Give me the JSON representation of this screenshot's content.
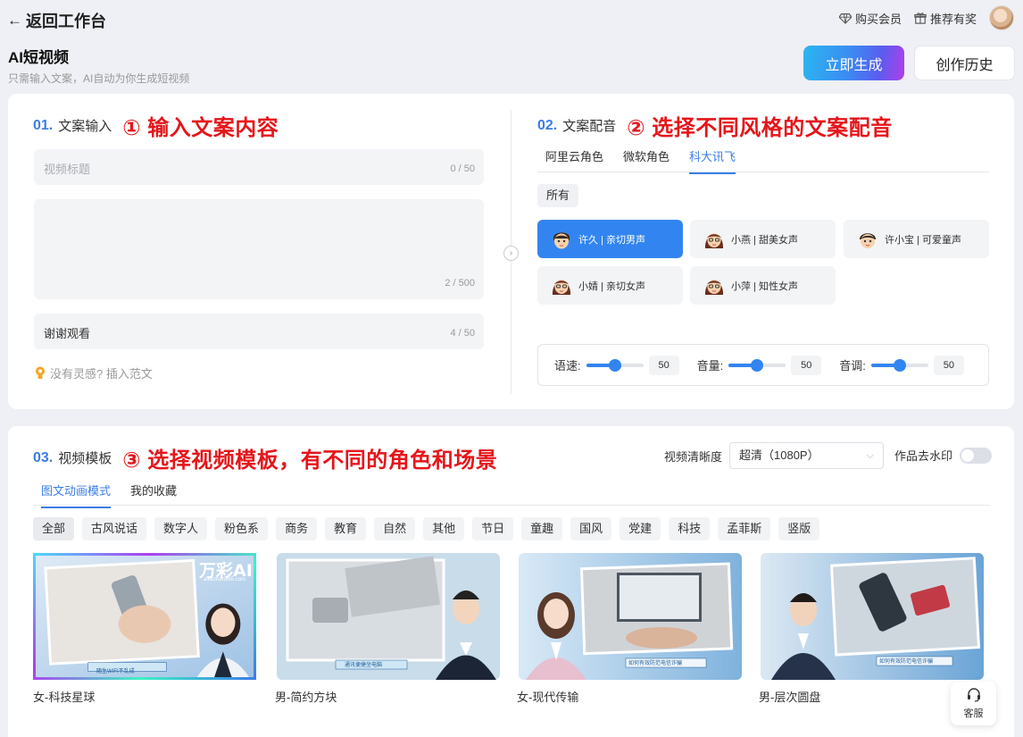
{
  "topbar": {
    "back_label": "返回工作台",
    "buy_vip": "购买会员",
    "referral": "推荐有奖"
  },
  "header": {
    "title": "AI短视频",
    "subtitle": "只需输入文案，AI自动为你生成短视频",
    "generate_label": "立即生成",
    "history_label": "创作历史"
  },
  "script_input": {
    "num": "01.",
    "title": "文案输入",
    "annotation": "① 输入文案内容",
    "title_placeholder": "视频标题",
    "title_count": "0 / 50",
    "body_count": "2 / 500",
    "ending_value": "谢谢观看",
    "ending_count": "4 / 50",
    "hint": "没有灵感? 插入范文"
  },
  "voice": {
    "num": "02.",
    "title": "文案配音",
    "annotation": "② 选择不同风格的文案配音",
    "tabs": [
      "阿里云角色",
      "微软角色",
      "科大讯飞"
    ],
    "active_tab": 2,
    "filter_all": "所有",
    "voices": [
      "许久 | 亲切男声",
      "小燕 | 甜美女声",
      "许小宝 | 可爱童声",
      "小婧 | 亲切女声",
      "小萍 | 知性女声"
    ],
    "speed_label": "语速:",
    "speed_value": "50",
    "volume_label": "音量:",
    "volume_value": "50",
    "pitch_label": "音调:",
    "pitch_value": "50",
    "level_fraction": 0.5
  },
  "template": {
    "num": "03.",
    "title": "视频模板",
    "annotation": "③ 选择视频模板，有不同的角色和场景",
    "resolution_label": "视频清晰度",
    "resolution_value": "超清（1080P）",
    "watermark_label": "作品去水印",
    "tabs": [
      "图文动画模式",
      "我的收藏"
    ],
    "filters": [
      "全部",
      "古风说话",
      "数字人",
      "粉色系",
      "商务",
      "教育",
      "自然",
      "其他",
      "节日",
      "童趣",
      "国风",
      "党建",
      "科技",
      "孟菲斯",
      "竖版"
    ],
    "cards": [
      "女-科技星球",
      "男-简约方块",
      "女-现代传输",
      "男-层次圆盘"
    ],
    "card1_brand": "万彩AI",
    "card1_url": "aikezhan365.com",
    "card1_caption": "随生WIFI不乱成",
    "card2_caption": "通讯便捷坐电脑",
    "card3_caption": "如何有效防范电信诈骗",
    "card4_caption": "如何有效防范电信诈骗"
  },
  "service": {
    "label": "客服"
  },
  "colors": {
    "accent": "#3285f1",
    "annotation_red": "#e5161b"
  }
}
